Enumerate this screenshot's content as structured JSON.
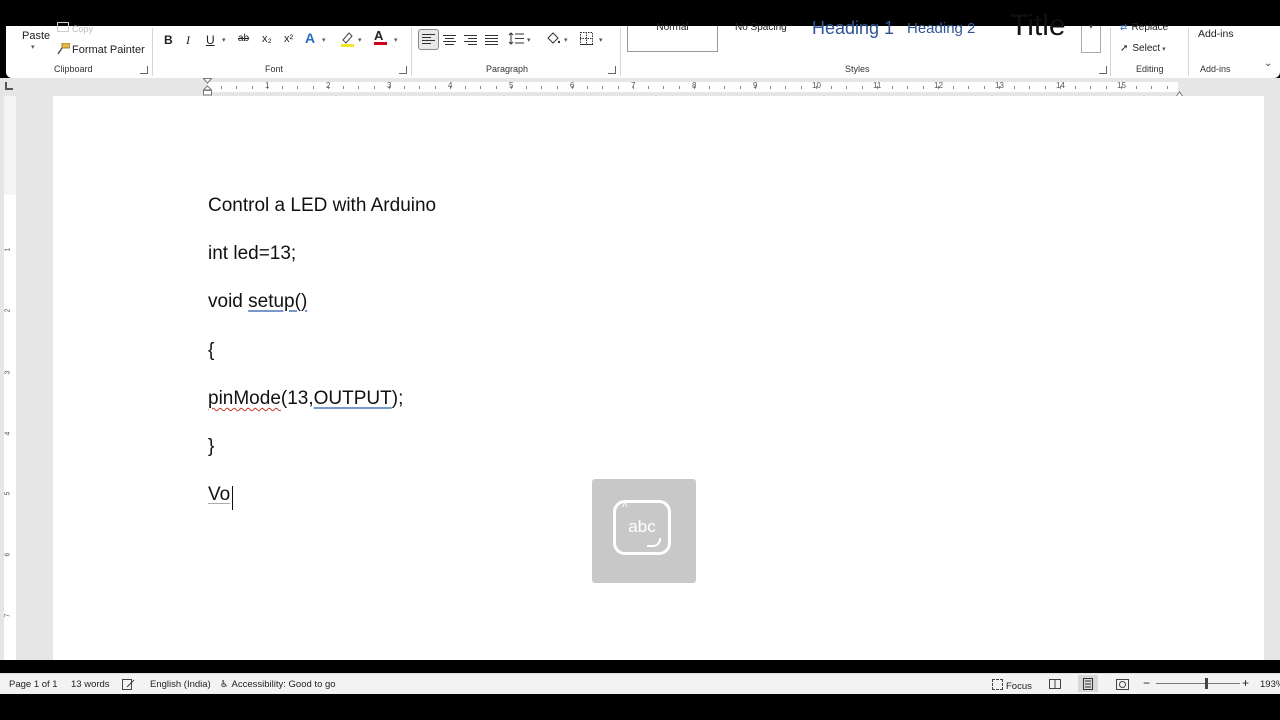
{
  "ribbon": {
    "clipboard": {
      "paste_label": "Paste",
      "copy_label": "Copy",
      "format_painter_label": "Format Painter",
      "group_label": "Clipboard"
    },
    "font": {
      "group_label": "Font",
      "bold": "B",
      "italic": "I",
      "underline": "U",
      "strike": "ab",
      "subscript": "x₂",
      "superscript": "x²",
      "text_effects": "A",
      "font_color": "A"
    },
    "paragraph": {
      "group_label": "Paragraph"
    },
    "styles": {
      "group_label": "Styles",
      "items": [
        "Normal",
        "No Spacing",
        "Heading 1",
        "Heading 2",
        "Title"
      ]
    },
    "editing": {
      "group_label": "Editing",
      "replace_label": "Replace",
      "select_label": "Select"
    },
    "addins": {
      "button_label": "Add-ins",
      "group_label": "Add-ins"
    }
  },
  "ruler": {
    "numbers": [
      "1",
      "2",
      "3",
      "4",
      "5",
      "6",
      "7",
      "8",
      "9",
      "10",
      "11",
      "12",
      "13",
      "14",
      "15"
    ],
    "vertical_numbers": [
      "1",
      "2",
      "3",
      "4",
      "5",
      "6",
      "7"
    ]
  },
  "document": {
    "lines": [
      "Control a LED with Arduino",
      "int led=13;",
      "void ",
      "setup()",
      "{",
      "pinMode",
      "(13,",
      "OUTPUT",
      ");",
      "}",
      "Vo"
    ]
  },
  "overlay": {
    "label": "abc"
  },
  "status": {
    "page": "Page 1 of 1",
    "words": "13 words",
    "language": "English (India)",
    "accessibility": "Accessibility: Good to go",
    "focus": "Focus",
    "zoom": "193%"
  },
  "colors": {
    "highlight": "#f5e625",
    "font_color": "#d0021b",
    "heading": "#2f5496",
    "page_bg": "#ffffff",
    "canvas_bg": "#e6e6e6"
  }
}
